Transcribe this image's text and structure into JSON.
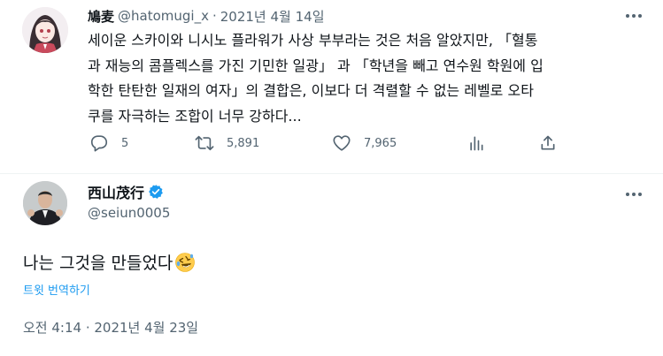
{
  "quoted_tweet": {
    "display_name": "鳩麦",
    "handle": "@hatomugi_x",
    "date": "2021년 4월 14일",
    "lines": [
      "세이운 스카이와 니시노 플라워가 사상 부부라는 것은 처음 알았지만, 「혈통",
      "과 재능의 콤플렉스를 가진 기민한 일광」 과 「학년을 빼고 연수원 학원에 입",
      "학한 탄탄한 일재의 여자」의 결합은, 이보다 더 격렬할 수 없는 레벨로 오타",
      "쿠를 자극하는 조합이 너무 강하다..."
    ],
    "actions": {
      "reply_count": "5",
      "retweet_count": "5,891",
      "like_count": "7,965"
    },
    "icons": [
      "reply-icon",
      "retweet-icon",
      "like-icon",
      "analytics-icon",
      "share-icon",
      "more-icon"
    ]
  },
  "main_tweet": {
    "display_name": "西山茂行",
    "handle": "@seiun0005",
    "verified": true,
    "text": "나는 그것을 만들었다",
    "emoji": "rolling-on-floor-laughing-emoji",
    "translate_label": "트윗 번역하기",
    "timestamp": "오전 4:14 · 2021년 4월 23일"
  },
  "colors": {
    "accent": "#1d9bf0",
    "muted_text": "#536471",
    "primary_text": "#0f1419",
    "divider": "#eff3f4"
  }
}
